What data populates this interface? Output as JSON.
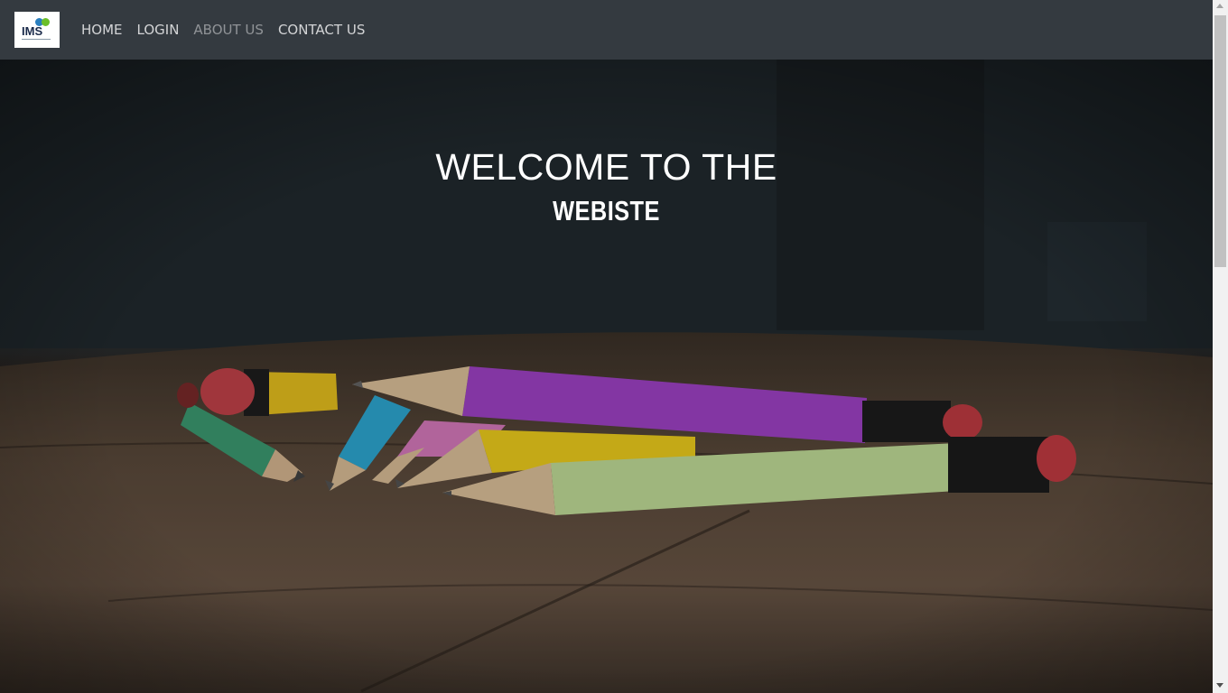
{
  "navbar": {
    "logo_text": "IMS",
    "links": [
      {
        "label": "HOME"
      },
      {
        "label": "LOGIN"
      },
      {
        "label": "ABOUT US"
      },
      {
        "label": "CONTACT US"
      }
    ],
    "active_link": "ABOUT US"
  },
  "hero": {
    "title": "WELCOME TO THE",
    "subtitle": "WEBISTE"
  },
  "colors": {
    "navbar_bg": "#343a40",
    "nav_link": "#c9cbcd",
    "nav_link_active": "#8b8e91",
    "hero_text": "#ffffff"
  },
  "icons": [
    "ims-logo-icon",
    "scroll-up-arrow-icon",
    "scroll-down-arrow-icon"
  ]
}
